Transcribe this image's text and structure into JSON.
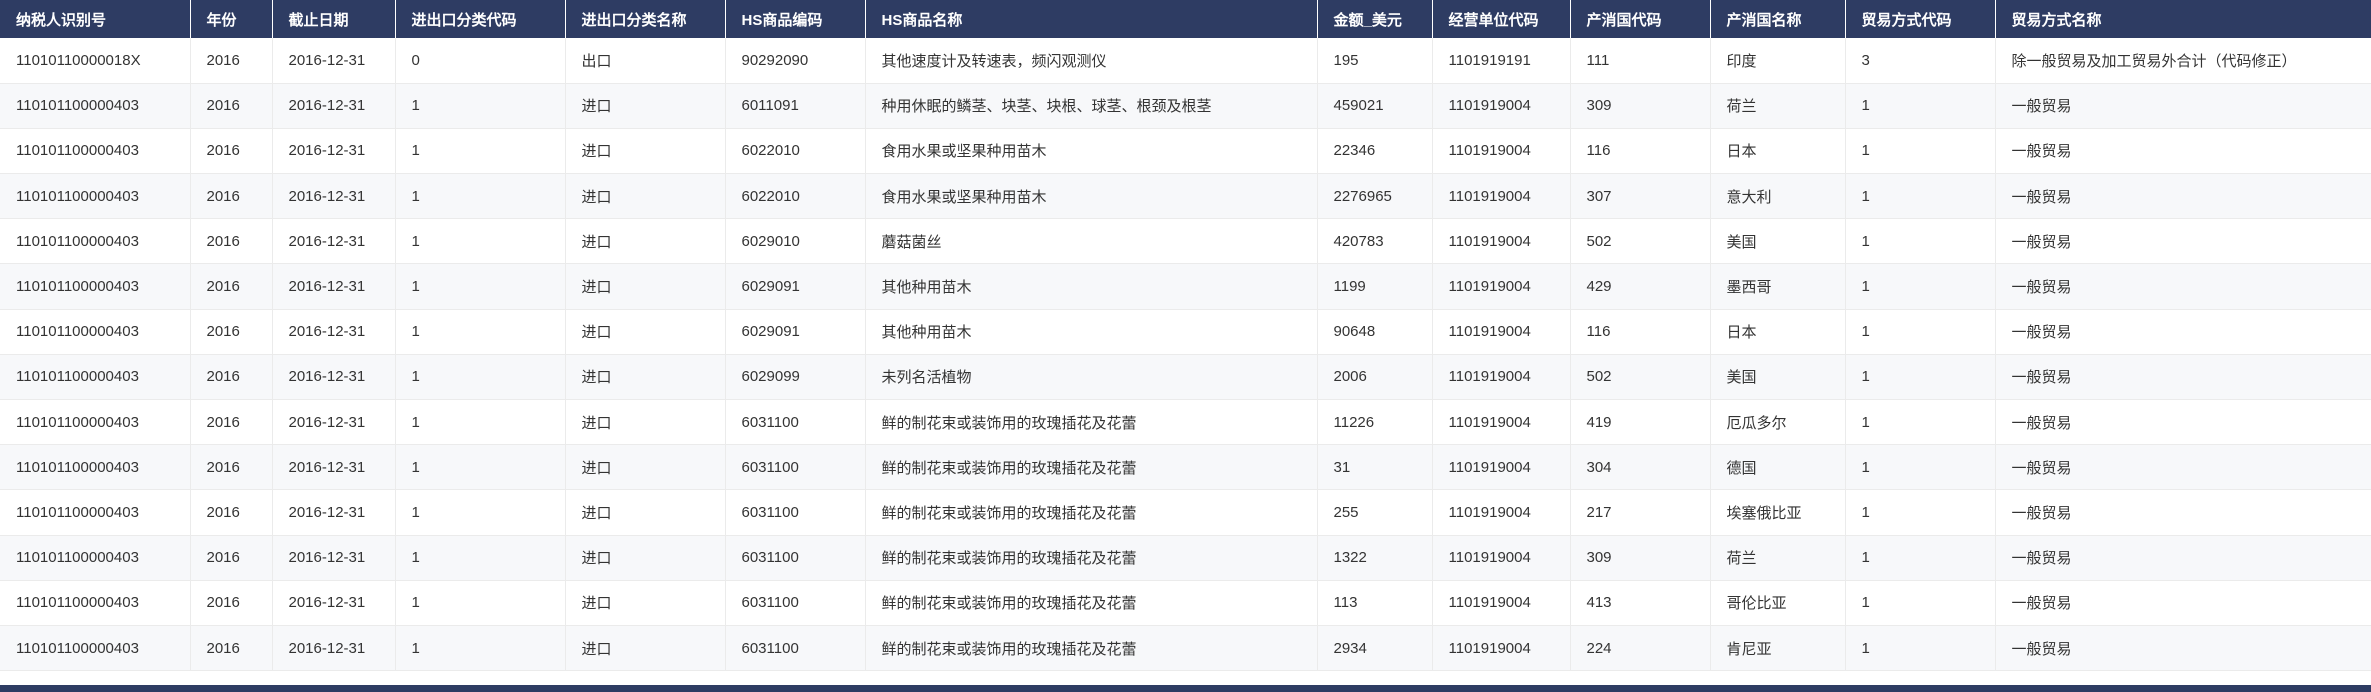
{
  "colors": {
    "header_bg": "#2e3c63",
    "header_text": "#ffffff",
    "row_alt_bg": "#f7f8fa",
    "border": "#ebebeb",
    "body_text": "#333333",
    "bottom_bar_bg": "#2e3c63"
  },
  "table": {
    "columns": [
      {
        "key": "taxpayer_id",
        "label": "纳税人识别号"
      },
      {
        "key": "year",
        "label": "年份"
      },
      {
        "key": "end_date",
        "label": "截止日期"
      },
      {
        "key": "ie_class_code",
        "label": "进出口分类代码"
      },
      {
        "key": "ie_class_name",
        "label": "进出口分类名称"
      },
      {
        "key": "hs_code",
        "label": "HS商品编码"
      },
      {
        "key": "hs_name",
        "label": "HS商品名称"
      },
      {
        "key": "amount_usd",
        "label": "金额_美元"
      },
      {
        "key": "op_unit_code",
        "label": "经营单位代码"
      },
      {
        "key": "country_code",
        "label": "产消国代码"
      },
      {
        "key": "country_name",
        "label": "产消国名称"
      },
      {
        "key": "trade_mode_code",
        "label": "贸易方式代码"
      },
      {
        "key": "trade_mode_name",
        "label": "贸易方式名称"
      }
    ],
    "rows": [
      {
        "taxpayer_id": "11010110000018X",
        "year": "2016",
        "end_date": "2016-12-31",
        "ie_class_code": "0",
        "ie_class_name": "出口",
        "hs_code": "90292090",
        "hs_name": "其他速度计及转速表，频闪观测仪",
        "amount_usd": "195",
        "op_unit_code": "1101919191",
        "country_code": "111",
        "country_name": "印度",
        "trade_mode_code": "3",
        "trade_mode_name": "除一般贸易及加工贸易外合计（代码修正）"
      },
      {
        "taxpayer_id": "110101100000403",
        "year": "2016",
        "end_date": "2016-12-31",
        "ie_class_code": "1",
        "ie_class_name": "进口",
        "hs_code": "6011091",
        "hs_name": "种用休眠的鳞茎、块茎、块根、球茎、根颈及根茎",
        "amount_usd": "459021",
        "op_unit_code": "1101919004",
        "country_code": "309",
        "country_name": "荷兰",
        "trade_mode_code": "1",
        "trade_mode_name": "一般贸易"
      },
      {
        "taxpayer_id": "110101100000403",
        "year": "2016",
        "end_date": "2016-12-31",
        "ie_class_code": "1",
        "ie_class_name": "进口",
        "hs_code": "6022010",
        "hs_name": "食用水果或坚果种用苗木",
        "amount_usd": "22346",
        "op_unit_code": "1101919004",
        "country_code": "116",
        "country_name": "日本",
        "trade_mode_code": "1",
        "trade_mode_name": "一般贸易"
      },
      {
        "taxpayer_id": "110101100000403",
        "year": "2016",
        "end_date": "2016-12-31",
        "ie_class_code": "1",
        "ie_class_name": "进口",
        "hs_code": "6022010",
        "hs_name": "食用水果或坚果种用苗木",
        "amount_usd": "2276965",
        "op_unit_code": "1101919004",
        "country_code": "307",
        "country_name": "意大利",
        "trade_mode_code": "1",
        "trade_mode_name": "一般贸易"
      },
      {
        "taxpayer_id": "110101100000403",
        "year": "2016",
        "end_date": "2016-12-31",
        "ie_class_code": "1",
        "ie_class_name": "进口",
        "hs_code": "6029010",
        "hs_name": "蘑菇菌丝",
        "amount_usd": "420783",
        "op_unit_code": "1101919004",
        "country_code": "502",
        "country_name": "美国",
        "trade_mode_code": "1",
        "trade_mode_name": "一般贸易"
      },
      {
        "taxpayer_id": "110101100000403",
        "year": "2016",
        "end_date": "2016-12-31",
        "ie_class_code": "1",
        "ie_class_name": "进口",
        "hs_code": "6029091",
        "hs_name": "其他种用苗木",
        "amount_usd": "1199",
        "op_unit_code": "1101919004",
        "country_code": "429",
        "country_name": "墨西哥",
        "trade_mode_code": "1",
        "trade_mode_name": "一般贸易"
      },
      {
        "taxpayer_id": "110101100000403",
        "year": "2016",
        "end_date": "2016-12-31",
        "ie_class_code": "1",
        "ie_class_name": "进口",
        "hs_code": "6029091",
        "hs_name": "其他种用苗木",
        "amount_usd": "90648",
        "op_unit_code": "1101919004",
        "country_code": "116",
        "country_name": "日本",
        "trade_mode_code": "1",
        "trade_mode_name": "一般贸易"
      },
      {
        "taxpayer_id": "110101100000403",
        "year": "2016",
        "end_date": "2016-12-31",
        "ie_class_code": "1",
        "ie_class_name": "进口",
        "hs_code": "6029099",
        "hs_name": "未列名活植物",
        "amount_usd": "2006",
        "op_unit_code": "1101919004",
        "country_code": "502",
        "country_name": "美国",
        "trade_mode_code": "1",
        "trade_mode_name": "一般贸易"
      },
      {
        "taxpayer_id": "110101100000403",
        "year": "2016",
        "end_date": "2016-12-31",
        "ie_class_code": "1",
        "ie_class_name": "进口",
        "hs_code": "6031100",
        "hs_name": "鲜的制花束或装饰用的玫瑰插花及花蕾",
        "amount_usd": "11226",
        "op_unit_code": "1101919004",
        "country_code": "419",
        "country_name": "厄瓜多尔",
        "trade_mode_code": "1",
        "trade_mode_name": "一般贸易"
      },
      {
        "taxpayer_id": "110101100000403",
        "year": "2016",
        "end_date": "2016-12-31",
        "ie_class_code": "1",
        "ie_class_name": "进口",
        "hs_code": "6031100",
        "hs_name": "鲜的制花束或装饰用的玫瑰插花及花蕾",
        "amount_usd": "31",
        "op_unit_code": "1101919004",
        "country_code": "304",
        "country_name": "德国",
        "trade_mode_code": "1",
        "trade_mode_name": "一般贸易"
      },
      {
        "taxpayer_id": "110101100000403",
        "year": "2016",
        "end_date": "2016-12-31",
        "ie_class_code": "1",
        "ie_class_name": "进口",
        "hs_code": "6031100",
        "hs_name": "鲜的制花束或装饰用的玫瑰插花及花蕾",
        "amount_usd": "255",
        "op_unit_code": "1101919004",
        "country_code": "217",
        "country_name": "埃塞俄比亚",
        "trade_mode_code": "1",
        "trade_mode_name": "一般贸易"
      },
      {
        "taxpayer_id": "110101100000403",
        "year": "2016",
        "end_date": "2016-12-31",
        "ie_class_code": "1",
        "ie_class_name": "进口",
        "hs_code": "6031100",
        "hs_name": "鲜的制花束或装饰用的玫瑰插花及花蕾",
        "amount_usd": "1322",
        "op_unit_code": "1101919004",
        "country_code": "309",
        "country_name": "荷兰",
        "trade_mode_code": "1",
        "trade_mode_name": "一般贸易"
      },
      {
        "taxpayer_id": "110101100000403",
        "year": "2016",
        "end_date": "2016-12-31",
        "ie_class_code": "1",
        "ie_class_name": "进口",
        "hs_code": "6031100",
        "hs_name": "鲜的制花束或装饰用的玫瑰插花及花蕾",
        "amount_usd": "113",
        "op_unit_code": "1101919004",
        "country_code": "413",
        "country_name": "哥伦比亚",
        "trade_mode_code": "1",
        "trade_mode_name": "一般贸易"
      },
      {
        "taxpayer_id": "110101100000403",
        "year": "2016",
        "end_date": "2016-12-31",
        "ie_class_code": "1",
        "ie_class_name": "进口",
        "hs_code": "6031100",
        "hs_name": "鲜的制花束或装饰用的玫瑰插花及花蕾",
        "amount_usd": "2934",
        "op_unit_code": "1101919004",
        "country_code": "224",
        "country_name": "肯尼亚",
        "trade_mode_code": "1",
        "trade_mode_name": "一般贸易"
      }
    ]
  }
}
